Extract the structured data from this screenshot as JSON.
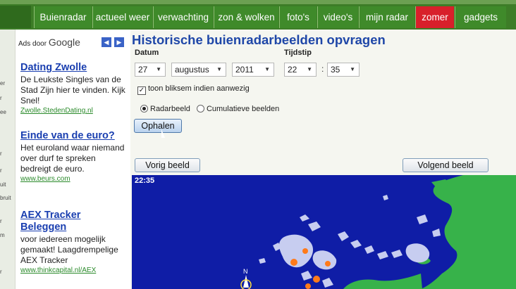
{
  "nav": {
    "tabs": [
      "Buienradar",
      "actueel weer",
      "verwachting",
      "zon & wolken",
      "foto's",
      "video's",
      "mijn radar",
      "zomer",
      "gadgets"
    ],
    "active_tab": "zomer",
    "active_color": "#d8202b"
  },
  "left_edge_fragments": [
    "er",
    "r",
    "ee",
    "r",
    "r",
    "uit",
    "bruit",
    "r",
    "m",
    "r"
  ],
  "ads": {
    "label_prefix": "Ads door",
    "label_brand": "Google",
    "prev_icon": "chevron-left-icon",
    "next_icon": "chevron-right-icon",
    "items": [
      {
        "title": "Dating Zwolle",
        "text": "De Leukste Singles van de Stad Zijn hier te vinden. Kijk Snel!",
        "url": "Zwolle.StedenDating.nl"
      },
      {
        "title": "Einde van de euro?",
        "text": "Het euroland waar niemand over durf te spreken bedreigt de euro.",
        "url": "www.beurs.com"
      },
      {
        "title": "AEX Tracker Beleggen",
        "text": "voor iedereen mogelijk gemaakt! Laagdrempelige AEX Tracker",
        "url": "www.thinkcapital.nl/AEX"
      }
    ]
  },
  "form": {
    "title": "Historische buienradarbeelden opvragen",
    "date_label": "Datum",
    "time_label": "Tijdstip",
    "day": "27",
    "month": "augustus",
    "year": "2011",
    "hour": "22",
    "minute": "35",
    "lightning_label": "toon bliksem indien aanwezig",
    "lightning_checked": true,
    "radio_radar": "Radarbeeld",
    "radio_cumulative": "Cumulatieve beelden",
    "radio_selected": "Radarbeeld",
    "fetch_button": "Ophalen",
    "prev_button": "Vorig beeld",
    "next_button": "Volgend beeld"
  },
  "radar": {
    "time": "22:35",
    "compass_label": "N",
    "sea_color": "#0f1da6",
    "land_color": "#37b24a",
    "rain_color": "#c7cdf0",
    "lightning_color": "#ff7a1a"
  }
}
